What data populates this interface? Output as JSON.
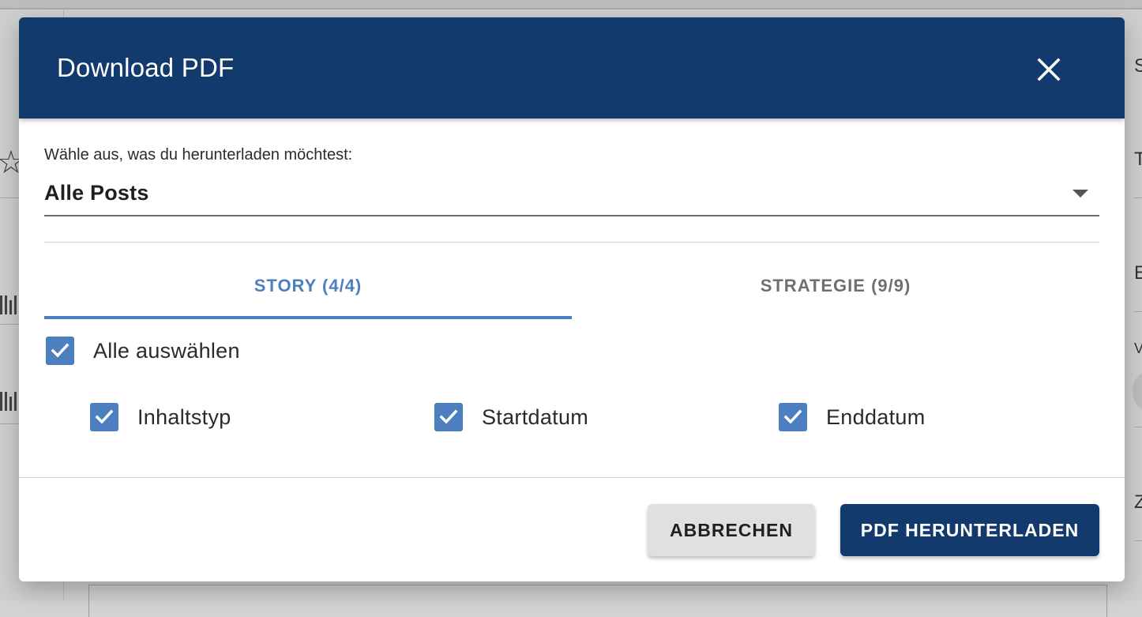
{
  "background": {
    "right_letters": [
      "S",
      "T",
      "E",
      "V",
      "Z"
    ]
  },
  "dialog": {
    "title": "Download PDF",
    "close_icon": "close-icon",
    "select": {
      "label": "Wähle aus, was du herunterladen möchtest:",
      "value": "Alle Posts"
    },
    "tabs": [
      {
        "label": "STORY (4/4)",
        "active": true
      },
      {
        "label": "STRATEGIE (9/9)",
        "active": false
      }
    ],
    "select_all": {
      "label": "Alle auswählen",
      "checked": true
    },
    "options": [
      {
        "label": "Inhaltstyp",
        "checked": true
      },
      {
        "label": "Startdatum",
        "checked": true
      },
      {
        "label": "Enddatum",
        "checked": true
      }
    ],
    "buttons": {
      "cancel": "ABBRECHEN",
      "download": "PDF HERUNTERLADEN"
    }
  },
  "colors": {
    "header": "#123a6d",
    "accent": "#4c7fbf",
    "overlay": "#cfcfcf"
  }
}
